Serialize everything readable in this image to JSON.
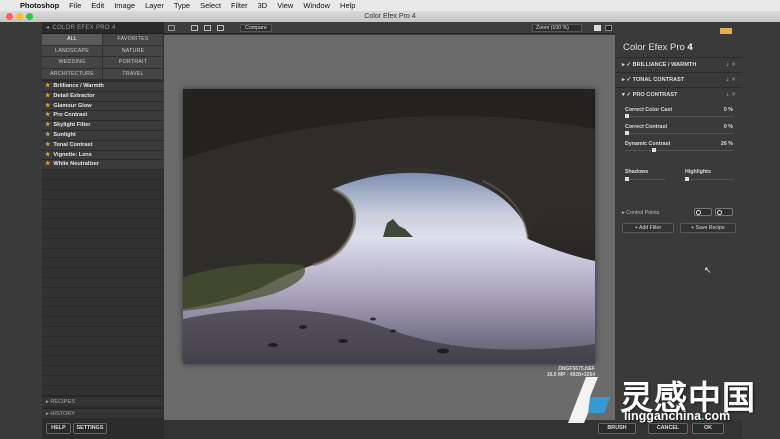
{
  "menubar": {
    "app": "Photoshop",
    "items": [
      "File",
      "Edit",
      "Image",
      "Layer",
      "Type",
      "Select",
      "Filter",
      "3D",
      "View",
      "Window",
      "Help"
    ]
  },
  "window": {
    "title": "Color Efex Pro 4"
  },
  "left_panel": {
    "header": "COLOR EFEX PRO 4",
    "categories": [
      "ALL",
      "FAVORITES",
      "LANDSCAPE",
      "NATURE",
      "WEDDING",
      "PORTRAIT",
      "ARCHITECTURE",
      "TRAVEL"
    ],
    "filters": [
      "Brilliance / Warmth",
      "Detail Extractor",
      "Glamour Glow",
      "Pro Contrast",
      "Skylight Filter",
      "Sunlight",
      "Tonal Contrast",
      "Vignette: Lens",
      "White Neutralizer"
    ],
    "recipes_label": "RECIPES",
    "history_label": "HISTORY",
    "help_label": "HELP",
    "settings_label": "SETTINGS"
  },
  "toolbar": {
    "compare_label": "Compare",
    "zoom_label": "Zoom (100 %)"
  },
  "canvas": {
    "caption_line1": "DNGF5675.NEF",
    "caption_line2": "16.0 MP · 4928×3264"
  },
  "right_panel": {
    "brand_main": "Color Efex Pro",
    "brand_num": "4",
    "stack": [
      "BRILLIANCE / WARMTH",
      "TONAL CONTRAST",
      "PRO CONTRAST"
    ],
    "sliders": [
      {
        "label": "Correct Color Cast",
        "value": "0 %",
        "level": 0
      },
      {
        "label": "Correct Contrast",
        "value": "0 %",
        "level": 0
      },
      {
        "label": "Dynamic Contrast",
        "value": "26 %",
        "level": 26
      }
    ],
    "shadows_label": "Shadows",
    "highlights_label": "Highlights",
    "control_points_label": "Control Points",
    "add_filter_label": "Add Filter",
    "save_recipe_label": "Save Recipe"
  },
  "bottom_bar": {
    "brush_label": "BRUSH",
    "cancel_label": "CANCEL",
    "ok_label": "OK"
  },
  "watermark": {
    "cn_text": "灵感中国",
    "en_prefix": "lingganchina",
    "en_dot": ".",
    "en_suffix": "com"
  },
  "colors": {
    "accent_star": "#d9a53a",
    "brand_swatch": "#e4b04a",
    "watermark_blue": "#4bb3e0"
  }
}
